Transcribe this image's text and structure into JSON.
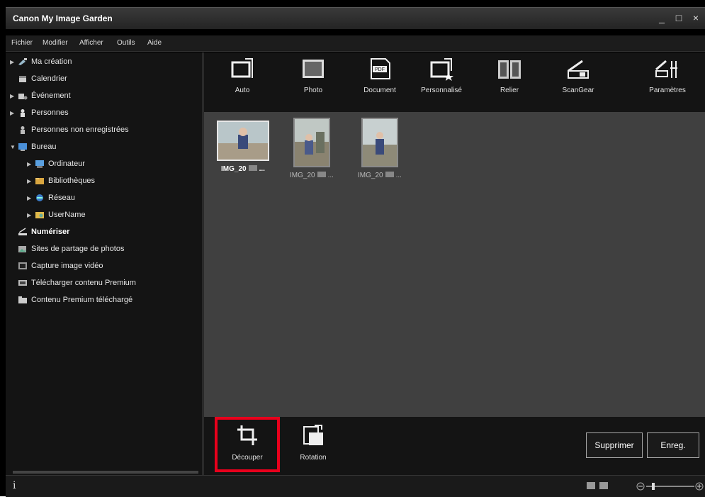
{
  "window": {
    "title": "Canon My Image Garden",
    "controls": [
      "_",
      "□",
      "×"
    ]
  },
  "menu": [
    "Fichier",
    "Modifier",
    "Afficher",
    "Outils",
    "Aide"
  ],
  "sidebar": {
    "items": [
      {
        "label": "Ma création",
        "icon": "creation-icon",
        "expandable": true
      },
      {
        "label": "Calendrier",
        "icon": "calendar-icon",
        "expandable": false
      },
      {
        "label": "Événement",
        "icon": "event-icon",
        "expandable": true
      },
      {
        "label": "Personnes",
        "icon": "person-icon",
        "expandable": true
      },
      {
        "label": "Personnes non enregistrées",
        "icon": "unregistered-person-icon",
        "expandable": false
      },
      {
        "label": "Bureau",
        "icon": "desktop-icon",
        "expandable": true,
        "expanded": true
      },
      {
        "label": "Ordinateur",
        "icon": "computer-icon",
        "expandable": true
      },
      {
        "label": "Bibliothèques",
        "icon": "library-icon",
        "expandable": true
      },
      {
        "label": "Réseau",
        "icon": "network-icon",
        "expandable": true
      },
      {
        "label": "UserName",
        "icon": "user-folder-icon",
        "expandable": true
      },
      {
        "label": "Numériser",
        "icon": "scanner-icon",
        "expandable": false,
        "selected": true
      },
      {
        "label": "Sites de partage de photos",
        "icon": "photo-share-icon",
        "expandable": false
      },
      {
        "label": "Capture image vidéo",
        "icon": "video-capture-icon",
        "expandable": false
      },
      {
        "label": "Télécharger contenu Premium",
        "icon": "download-icon",
        "expandable": false
      },
      {
        "label": "Contenu Premium téléchargé",
        "icon": "folder-icon",
        "expandable": false
      }
    ]
  },
  "toolbar": {
    "items": [
      {
        "label": "Auto",
        "icon": "auto-scan-icon"
      },
      {
        "label": "Photo",
        "icon": "photo-scan-icon"
      },
      {
        "label": "Document",
        "icon": "document-scan-icon"
      },
      {
        "label": "Personnalisé",
        "icon": "custom-scan-icon"
      },
      {
        "label": "Relier",
        "icon": "stitch-icon"
      },
      {
        "label": "ScanGear",
        "icon": "scangear-icon"
      },
      {
        "label": "Paramètres",
        "icon": "settings-icon"
      }
    ]
  },
  "thumbnails": [
    {
      "label": "IMG_20",
      "suffix": "...",
      "selected": true
    },
    {
      "label": "IMG_20",
      "suffix": "...",
      "selected": false
    },
    {
      "label": "IMG_20",
      "suffix": "...",
      "selected": false
    }
  ],
  "edit": {
    "crop_label": "Découper",
    "rotate_label": "Rotation",
    "delete_label": "Supprimer",
    "save_label": "Enreg."
  },
  "status": {
    "info_icon": "i"
  },
  "colors": {
    "highlight": "#e8001c",
    "background": "#3c3c3c",
    "panel": "#141414"
  }
}
